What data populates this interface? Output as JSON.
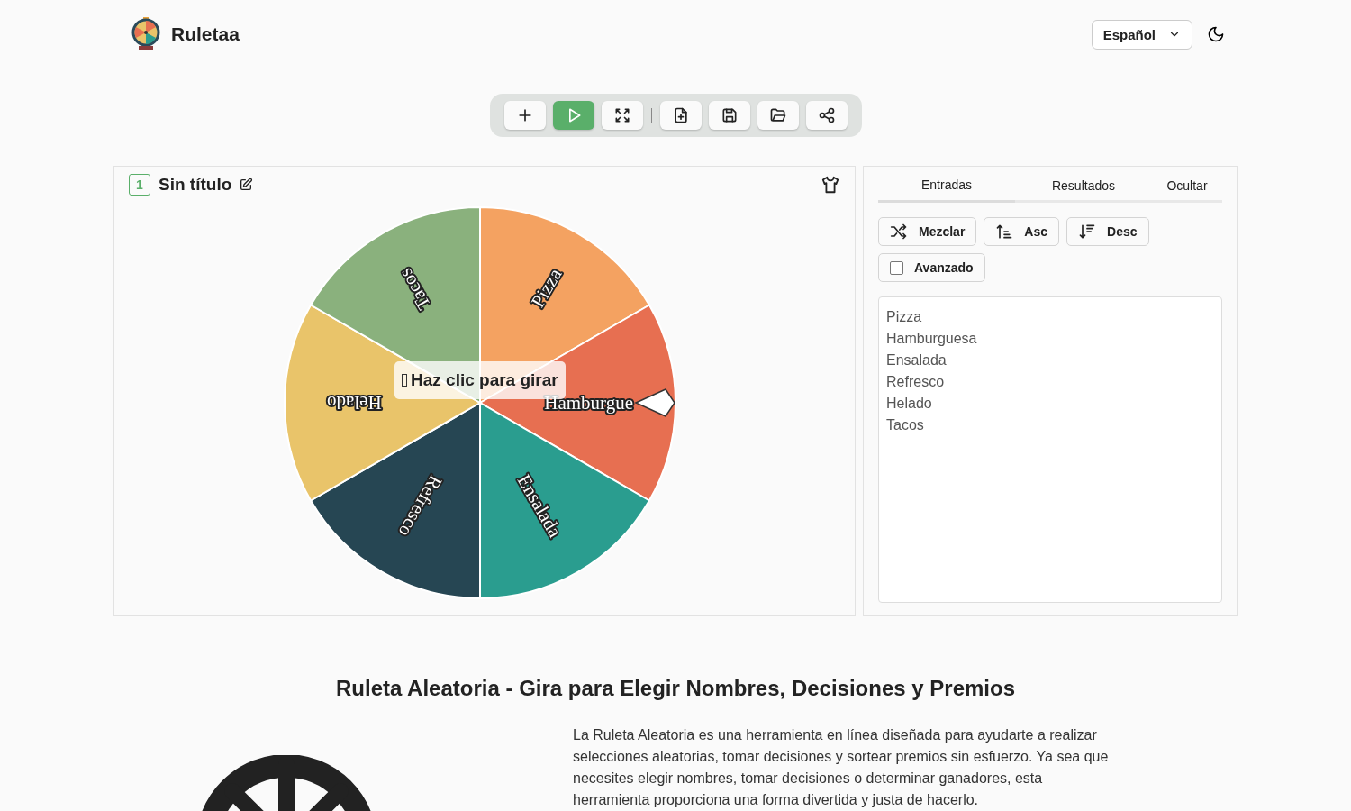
{
  "header": {
    "brand": "Ruletaa",
    "language": "Español"
  },
  "toolbar": [
    {
      "kind": "add",
      "active": false
    },
    {
      "kind": "play",
      "active": true
    },
    {
      "kind": "fullscreen",
      "active": false
    },
    {
      "kind": "separator"
    },
    {
      "kind": "new-file",
      "active": false
    },
    {
      "kind": "save",
      "active": false
    },
    {
      "kind": "open",
      "active": false
    },
    {
      "kind": "share",
      "active": false
    }
  ],
  "wheel_panel": {
    "number": "1",
    "title": "Sin título",
    "hint": "Haz clic para girar",
    "slices": [
      {
        "label": "Pizza",
        "color": "#f4a261"
      },
      {
        "label": "Hamburgue",
        "color": "#e76f51"
      },
      {
        "label": "Ensalada",
        "color": "#2a9d8f"
      },
      {
        "label": "Refresco",
        "color": "#264653"
      },
      {
        "label": "Helado",
        "color": "#e9c46a"
      },
      {
        "label": "Tacos",
        "color": "#8ab17d"
      }
    ]
  },
  "side_panel": {
    "tabs": [
      {
        "label": "Entradas",
        "selected": true
      },
      {
        "label": "Resultados",
        "selected": false
      },
      {
        "label": "Ocultar",
        "selected": false
      }
    ],
    "actions": [
      {
        "kind": "shuffle",
        "label": "Mezclar"
      },
      {
        "kind": "asc",
        "label": "Asc"
      },
      {
        "kind": "desc",
        "label": "Desc"
      }
    ],
    "advanced": {
      "label": "Avanzado",
      "checked": false
    },
    "entries": [
      "Pizza",
      "Hamburguesa",
      "Ensalada",
      "Refresco",
      "Helado",
      "Tacos"
    ]
  },
  "article": {
    "heading": "Ruleta Aleatoria - Gira para Elegir Nombres, Decisiones y Premios",
    "paragraph": "La Ruleta Aleatoria es una herramienta en línea diseñada para ayudarte a realizar selecciones aleatorias, tomar decisiones y sortear premios sin esfuerzo. Ya sea que necesites elegir nombres, tomar decisiones o determinar ganadores, esta herramienta proporciona una forma divertida y justa de hacerlo."
  }
}
